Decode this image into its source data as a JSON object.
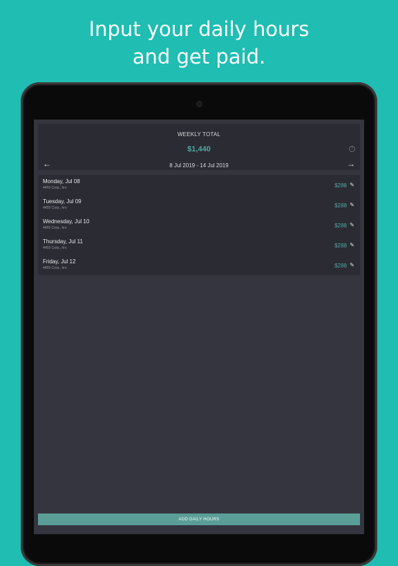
{
  "headline": {
    "line1": "Input your daily hours",
    "line2": "and get paid."
  },
  "header": {
    "weekly_label": "WEEKLY TOTAL",
    "weekly_total": "$1,440",
    "date_range": "8 Jul 2019 - 14 Jul 2019",
    "help_icon": "question-circle-icon",
    "prev_icon": "arrow-left-icon",
    "next_icon": "arrow-right-icon"
  },
  "days": [
    {
      "name": "Monday, Jul 08",
      "sub": "4455 Corp., hrs",
      "amount": "$288"
    },
    {
      "name": "Tuesday, Jul 09",
      "sub": "4455 Corp., hrs",
      "amount": "$288"
    },
    {
      "name": "Wednesday, Jul 10",
      "sub": "4455 Corp., hrs",
      "amount": "$288"
    },
    {
      "name": "Thursday, Jul 11",
      "sub": "4455 Corp., hrs",
      "amount": "$288"
    },
    {
      "name": "Friday, Jul 12",
      "sub": "4455 Corp., hrs",
      "amount": "$288"
    }
  ],
  "add_button": {
    "label": "ADD DAILY HOURS"
  },
  "colors": {
    "background": "#1fbdb2",
    "accent": "#4fa9a0",
    "card": "#2b2b33",
    "screen": "#35353f",
    "button": "#5a9e97"
  }
}
